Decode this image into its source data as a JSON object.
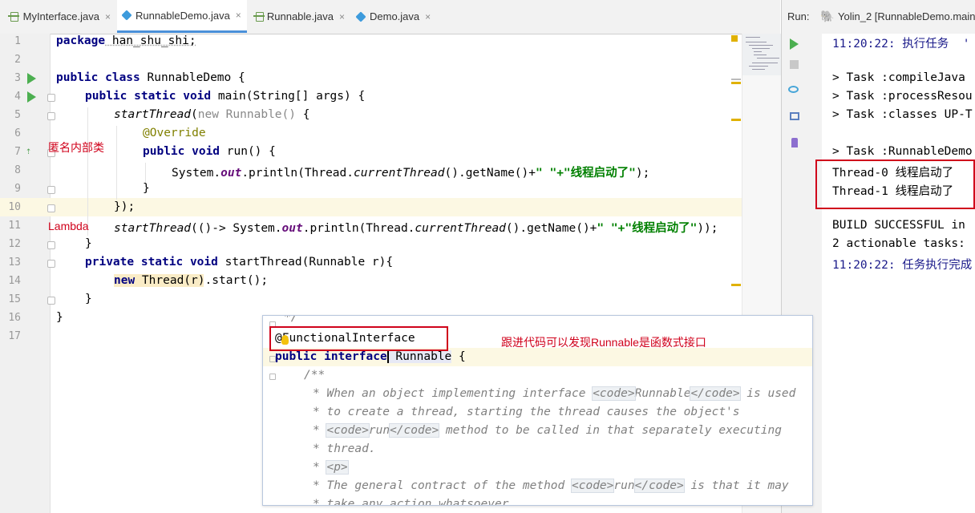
{
  "tabs": [
    {
      "label": "MyInterface.java",
      "icon": "interface-icon",
      "active": false
    },
    {
      "label": "RunnableDemo.java",
      "icon": "class-icon",
      "active": true
    },
    {
      "label": "Runnable.java",
      "icon": "interface-icon",
      "active": false
    },
    {
      "label": "Demo.java",
      "icon": "class-icon",
      "active": false
    }
  ],
  "tab_close": "×",
  "run_panel": {
    "label": "Run:",
    "config": "Yolin_2 [RunnableDemo.main("
  },
  "editor": {
    "line_numbers": [
      "1",
      "2",
      "3",
      "4",
      "5",
      "6",
      "7",
      "8",
      "9",
      "10",
      "11",
      "12",
      "13",
      "14",
      "15",
      "16",
      "17"
    ],
    "lines": {
      "l1a": "package",
      "l1b": " han_shu_shi;",
      "l3a": "public class",
      "l3b": " RunnableDemo {",
      "l4a": "public static void",
      "l4b": " main(String[] args) {",
      "l5a": "startThread",
      "l5b": "(",
      "l5c": "new Runnable()",
      "l5d": " {",
      "l6": "@Override",
      "l7a": "public void",
      "l7b": " run() {",
      "l8a": "System.",
      "l8b": "out",
      "l8c": ".println(Thread.",
      "l8d": "currentThread",
      "l8e": "().getName()+",
      "l8f": "\" \"+\"线程启动了\"",
      "l8g": ");",
      "l9": "}",
      "l10": "});",
      "l11a": "startThread",
      "l11b": "(()-> System.",
      "l11c": "out",
      "l11d": ".println(Thread.",
      "l11e": "currentThread",
      "l11f": "().getName()+",
      "l11g": "\" \"+\"线程启动了\"",
      "l11h": "));",
      "l12": "}",
      "l13a": "private static void",
      "l13b": " startThread(Runnable r){",
      "l14a": "new",
      "l14b": " Thread(r).start();",
      "l15": "}",
      "l16": "}"
    },
    "annotations": {
      "anonymous": "匿名内部类",
      "lambda": "Lambda"
    }
  },
  "console": {
    "lines": [
      "11:20:22: 执行任务  '",
      "",
      "> Task :compileJava",
      "> Task :processResou",
      "> Task :classes UP-T",
      "",
      "> Task :RunnableDemo",
      "Thread-0 线程启动了",
      "Thread-1 线程启动了",
      "",
      "BUILD SUCCESSFUL in",
      "2 actionable tasks:",
      "11:20:22: 任务执行完成"
    ]
  },
  "popup": {
    "lines": {
      "p0": "*/",
      "p1": "@FunctionalInterface",
      "p2a": "public interface",
      "p2b": " Runnable",
      "p2c": " {",
      "p3": "/**",
      "p4a": "* When an object implementing interface ",
      "p4b": "<code>",
      "p4c": "Runnable",
      "p4d": "</code>",
      "p4e": " is used",
      "p5": "* to create a thread, starting the thread causes the object's",
      "p6a": "* ",
      "p6b": "<code>",
      "p6c": "run",
      "p6d": "</code>",
      "p6e": " method to be called in that separately executing",
      "p7": "* thread.",
      "p8a": "* ",
      "p8b": "<p>",
      "p9a": "* The general contract of the method ",
      "p9b": "<code>",
      "p9c": "run",
      "p9d": "</code>",
      "p9e": " is that it may",
      "p10": "* take any action whatsoever."
    },
    "note": "跟进代码可以发现Runnable是函数式接口"
  },
  "colors": {
    "accent_tab": "#4a90d9",
    "annotation_red": "#d0021b",
    "keyword": "#000080",
    "string": "#008000"
  }
}
